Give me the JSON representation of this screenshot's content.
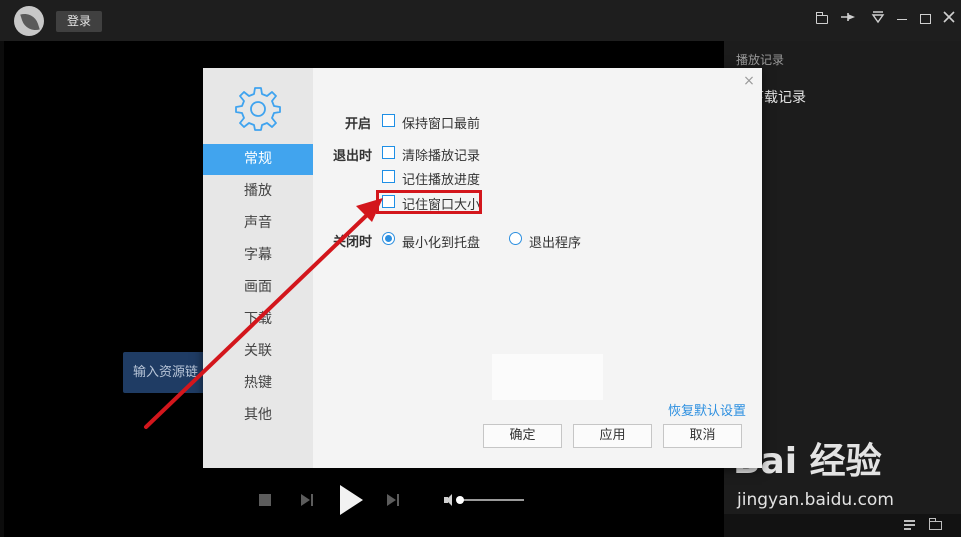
{
  "titlebar": {
    "login_label": "登录",
    "icons": [
      "logo-icon",
      "folder-icon",
      "pin-icon",
      "filter-icon",
      "minimize-icon",
      "maximize-icon",
      "close-icon"
    ]
  },
  "player": {
    "resource_input_placeholder": "输入资源链",
    "volume_level": 0.0
  },
  "right_panel": {
    "title": "播放记录",
    "item": "雷下载记录"
  },
  "dialog": {
    "nav_items": [
      "常规",
      "播放",
      "声音",
      "字幕",
      "画面",
      "下载",
      "关联",
      "热键",
      "其他"
    ],
    "active_nav": "常规",
    "sections": {
      "start_label": "开启",
      "exit_label": "退出时",
      "close_label": "关闭时"
    },
    "start_options": [
      {
        "label": "保持窗口最前",
        "checked": false
      }
    ],
    "exit_options": [
      {
        "label": "清除播放记录",
        "checked": false
      },
      {
        "label": "记住播放进度",
        "checked": false
      },
      {
        "label": "记住窗口大小",
        "checked": false
      }
    ],
    "close_options": [
      {
        "label": "最小化到托盘",
        "selected": true
      },
      {
        "label": "退出程序",
        "selected": false
      }
    ],
    "restore_default": "恢复默认设置",
    "buttons": {
      "ok": "确定",
      "apply": "应用",
      "cancel": "取消"
    },
    "close_glyph": "×"
  },
  "watermark": {
    "brand": "Bai 经验",
    "sub": "jingyan.baidu.com"
  },
  "colors": {
    "accent": "#41a4ee",
    "highlight": "#d3161c",
    "link": "#2c8fe0"
  }
}
